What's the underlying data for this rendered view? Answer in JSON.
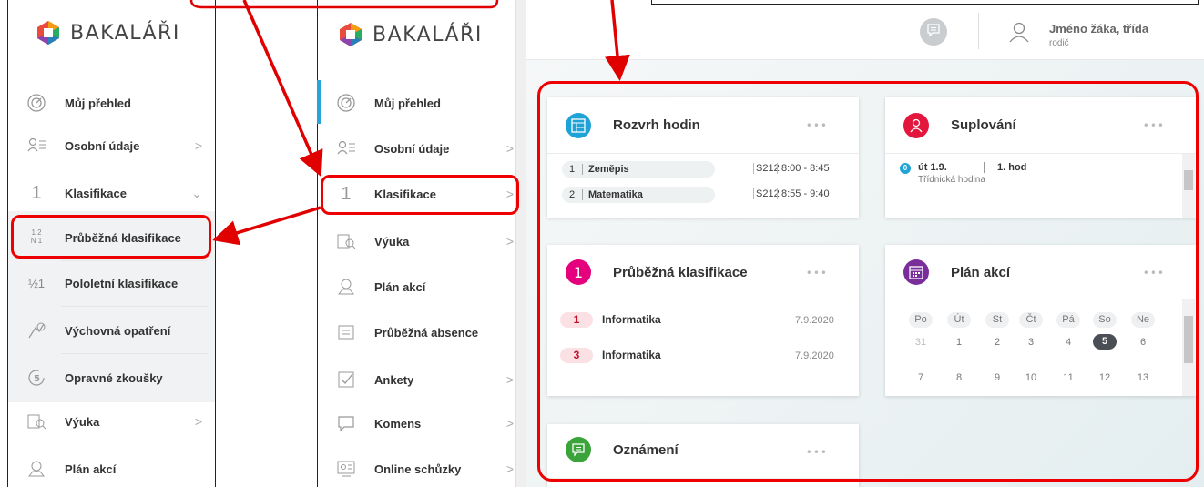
{
  "brand": "BAKALÁŘI",
  "left_menu": {
    "items": [
      {
        "label": "Můj přehled",
        "icon": "dashboard-icon"
      },
      {
        "label": "Osobní údaje",
        "icon": "person-card-icon"
      },
      {
        "label": "Klasifikace",
        "icon": "grade-one-icon"
      },
      {
        "label": "Průběžná klasifikace",
        "icon": "fraction-grades-icon"
      },
      {
        "label": "Pololetní klasifikace",
        "icon": "half-grade-icon"
      },
      {
        "label": "Výchovná opatření",
        "icon": "award-icon"
      },
      {
        "label": "Opravné zkoušky",
        "icon": "retake-icon"
      },
      {
        "label": "Výuka",
        "icon": "lesson-icon"
      },
      {
        "label": "Plán akcí",
        "icon": "map-pin-icon"
      }
    ]
  },
  "mid_menu": {
    "items": [
      {
        "label": "Můj přehled"
      },
      {
        "label": "Osobní údaje"
      },
      {
        "label": "Klasifikace"
      },
      {
        "label": "Výuka"
      },
      {
        "label": "Plán akcí"
      },
      {
        "label": "Průběžná absence"
      },
      {
        "label": "Ankety"
      },
      {
        "label": "Komens"
      },
      {
        "label": "Online schůzky"
      }
    ]
  },
  "header": {
    "user_name": "Jméno žáka, třída",
    "user_role": "rodič"
  },
  "cards": {
    "rozvrh": {
      "title": "Rozvrh hodin",
      "rows": [
        {
          "n": "1",
          "subject": "Zeměpis",
          "room": "S212",
          "time": "8:00 - 8:45"
        },
        {
          "n": "2",
          "subject": "Matematika",
          "room": "S212",
          "time": "8:55 - 9:40"
        }
      ]
    },
    "suplovani": {
      "title": "Suplování",
      "badge": "0",
      "day": "út 1.9.",
      "hour": "1. hod",
      "note": "Třídnická hodina"
    },
    "klasifikace": {
      "title": "Průběžná klasifikace",
      "rows": [
        {
          "grade": "1",
          "subject": "Informatika",
          "date": "7.9.2020"
        },
        {
          "grade": "3",
          "subject": "Informatika",
          "date": "7.9.2020"
        }
      ]
    },
    "plan": {
      "title": "Plán akcí",
      "days": [
        "Po",
        "Út",
        "St",
        "Čt",
        "Pá",
        "So",
        "Ne"
      ],
      "week1": [
        "31",
        "1",
        "2",
        "3",
        "4",
        "5",
        "6"
      ],
      "week2": [
        "7",
        "8",
        "9",
        "10",
        "11",
        "12",
        "13"
      ]
    },
    "oznameni": {
      "title": "Oznámení"
    },
    "dots": "•••"
  },
  "colors": {
    "accent_blue": "#1fa3d6",
    "accent_red": "#e3173e",
    "accent_pink": "#e5007e",
    "accent_purple": "#7a2e9a",
    "accent_green": "#3aa33a",
    "highlight_red": "#e00000"
  }
}
